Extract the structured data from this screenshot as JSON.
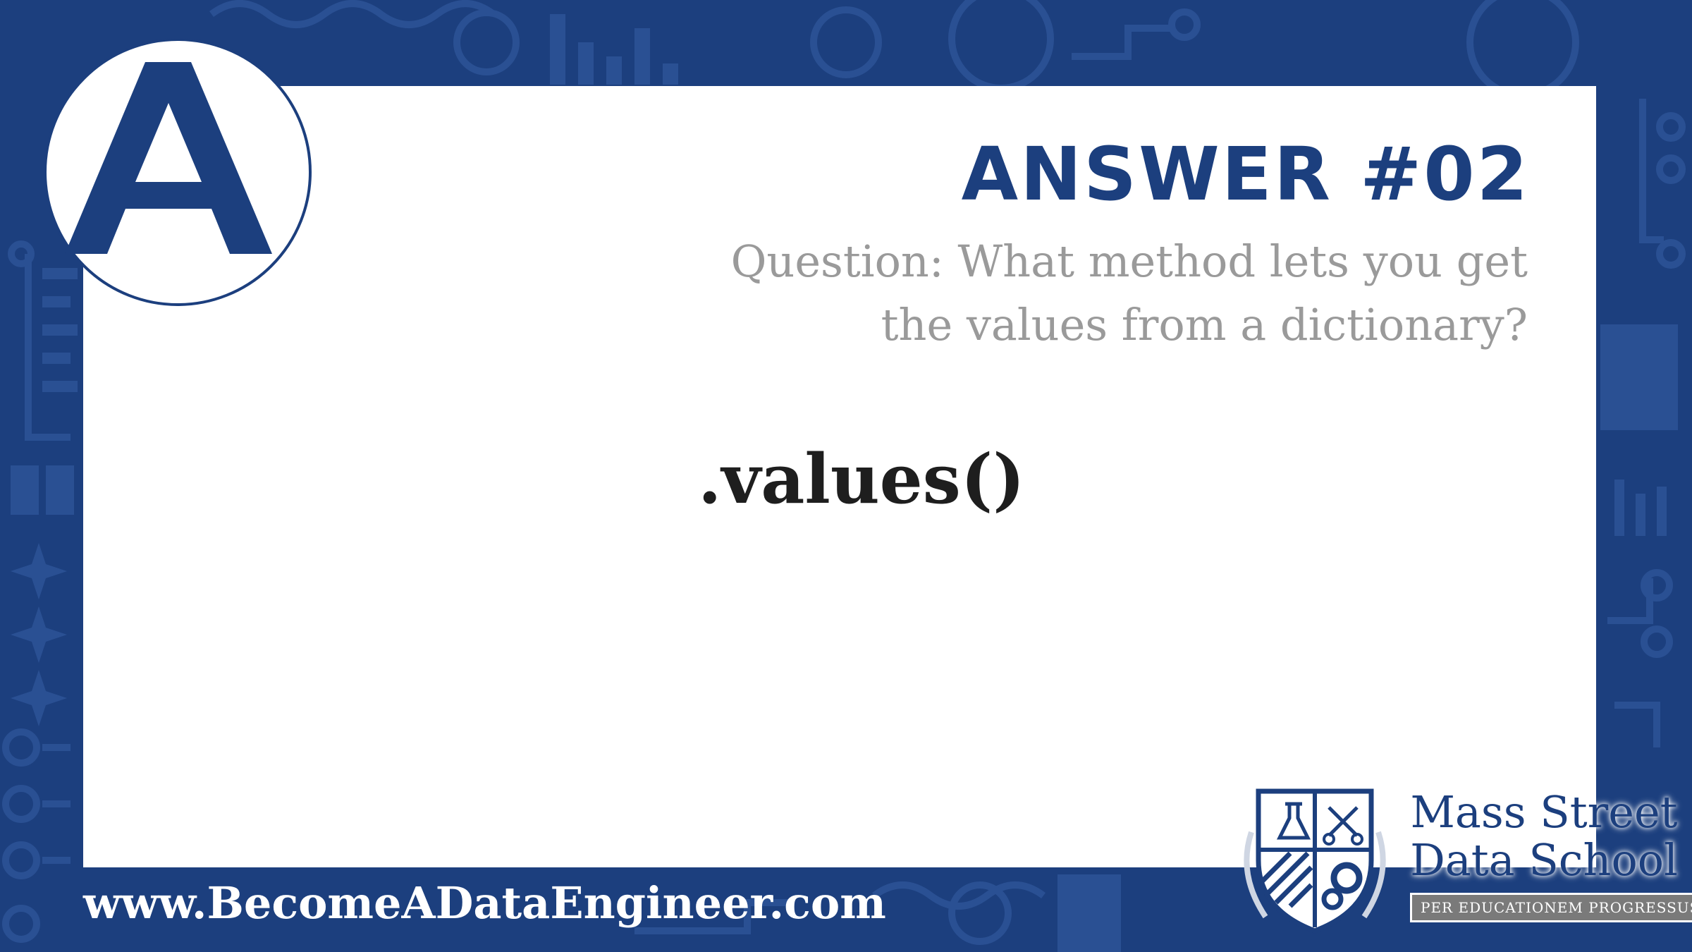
{
  "slide": {
    "badge_letter": "A",
    "title": "ANSWER #02",
    "question": "Question: What method lets you get the values from a dictionary?",
    "answer": ".values()",
    "website": "www.BecomeADataEngineer.com"
  },
  "brand": {
    "name_line1": "Mass Street",
    "name_line2": "Data School",
    "motto": "PER EDUCATIONEM PROGRESSUS"
  },
  "colors": {
    "navy": "#1c3f7e",
    "background_pattern": "#284d8f",
    "question_gray": "#9a9a9a",
    "answer_text": "#1e1e1e"
  },
  "icons": {
    "badge": "letter-a-badge",
    "crest": "school-crest-icon"
  }
}
